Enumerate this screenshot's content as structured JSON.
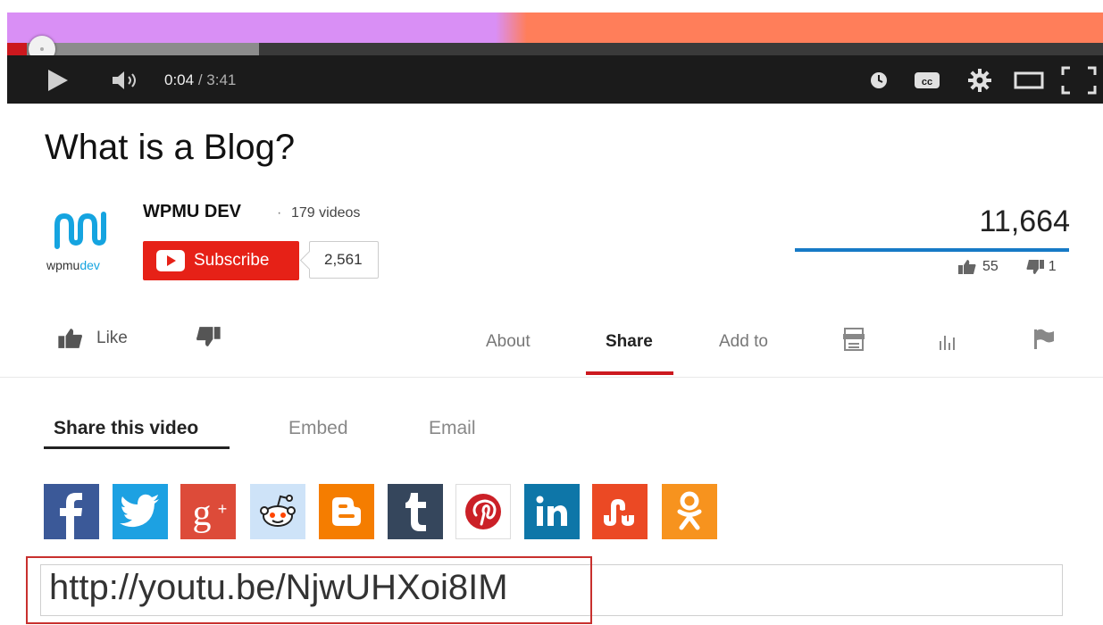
{
  "player": {
    "current_time": "0:04",
    "separator": " / ",
    "duration": "3:41",
    "played_fraction": 0.018,
    "buffered_fraction": 0.23
  },
  "video": {
    "title": "What is a Blog?",
    "views": "11,664",
    "likes": "55",
    "dislikes": "1"
  },
  "channel": {
    "logo_text_a": "wpmu",
    "logo_text_b": "dev",
    "name": "WPMU DEV",
    "separator": "·",
    "videos": "179 videos",
    "subscribe_label": "Subscribe",
    "subscriber_count": "2,561"
  },
  "actions": {
    "like_label": "Like",
    "tabs": [
      {
        "label": "About",
        "active": false
      },
      {
        "label": "Share",
        "active": true
      },
      {
        "label": "Add to",
        "active": false
      }
    ]
  },
  "share": {
    "sub_tabs": [
      {
        "label": "Share this video",
        "active": true
      },
      {
        "label": "Embed",
        "active": false
      },
      {
        "label": "Email",
        "active": false
      }
    ],
    "networks": [
      {
        "name": "facebook-icon",
        "color": "#3b5998"
      },
      {
        "name": "twitter-icon",
        "color": "#1da1e2"
      },
      {
        "name": "google-plus-icon",
        "color": "#dd4b39"
      },
      {
        "name": "reddit-icon",
        "color": "#cee3f8"
      },
      {
        "name": "blogger-icon",
        "color": "#f57d00"
      },
      {
        "name": "tumblr-icon",
        "color": "#35465c"
      },
      {
        "name": "pinterest-icon",
        "color": "#ffffff"
      },
      {
        "name": "linkedin-icon",
        "color": "#0e76a8"
      },
      {
        "name": "stumbleupon-icon",
        "color": "#eb4924"
      },
      {
        "name": "odnoklassniki-icon",
        "color": "#f7931e"
      }
    ],
    "url": "http://youtu.be/NjwUHXoi8IM"
  },
  "colors": {
    "accent_red": "#cc181e",
    "subscribe_red": "#e62117",
    "sentiment_blue": "#167ac6"
  }
}
